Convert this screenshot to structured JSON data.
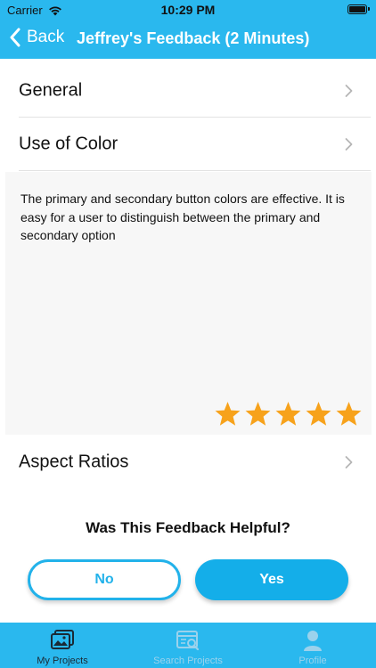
{
  "status_bar": {
    "carrier": "Carrier",
    "time": "10:29 PM"
  },
  "nav": {
    "back_label": "Back",
    "title": "Jeffrey's Feedback (2 Minutes)"
  },
  "sections": [
    {
      "label": "General"
    },
    {
      "label": "Use of Color"
    },
    {
      "label": "Aspect Ratios"
    }
  ],
  "feedback": {
    "text": "The primary and secondary button colors are effective. It is easy for a user to distinguish between the primary and secondary option",
    "rating": 5,
    "max_rating": 5
  },
  "helpful": {
    "question": "Was This Feedback Helpful?",
    "no_label": "No",
    "yes_label": "Yes"
  },
  "tab_bar": {
    "tabs": [
      {
        "label": "My Projects",
        "icon": "image-gallery-icon",
        "active": true
      },
      {
        "label": "Search Projects",
        "icon": "search-projects-icon",
        "active": false
      },
      {
        "label": "Profile",
        "icon": "person-icon",
        "active": false
      }
    ]
  },
  "colors": {
    "accent": "#2ab8ee",
    "star": "#f7a21b",
    "primary_button": "#14aee9"
  }
}
